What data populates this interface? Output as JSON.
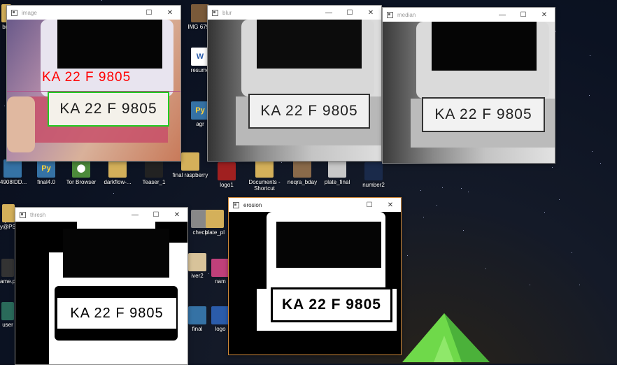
{
  "desktop": {
    "icons": [
      {
        "name": "desktop-icon-img",
        "label": "IMG 6795",
        "color": "#7a5a3a"
      },
      {
        "name": "desktop-icon-resume",
        "label": "resume",
        "color": "#2b5caa"
      },
      {
        "name": "desktop-icon-agr",
        "label": "agr",
        "color": "#3572a5"
      },
      {
        "name": "desktop-icon-final40",
        "label": "final4.0",
        "color": "#3572a5"
      },
      {
        "name": "desktop-icon-tor",
        "label": "Tor Browser",
        "color": "#4c8a3a"
      },
      {
        "name": "desktop-icon-darkflow",
        "label": "darkflow-...",
        "color": "#c8a24a"
      },
      {
        "name": "desktop-icon-teaser",
        "label": "Teaser_1",
        "color": "#222"
      },
      {
        "name": "desktop-icon-final-raspberry",
        "label": "final raspberry",
        "color": "#d4b05a"
      },
      {
        "name": "desktop-icon-logo1",
        "label": "logo1",
        "color": "#a02020"
      },
      {
        "name": "desktop-icon-documents",
        "label": "Documents - Shortcut",
        "color": "#d4b05a"
      },
      {
        "name": "desktop-icon-neqra",
        "label": "neqra_bday",
        "color": "#8a6a4a"
      },
      {
        "name": "desktop-icon-plate-final",
        "label": "plate_final",
        "color": "#c8c8c8"
      },
      {
        "name": "desktop-icon-number2",
        "label": "number2",
        "color": "#1a2a4a"
      },
      {
        "name": "desktop-icon-4908",
        "label": "4908IDD...",
        "color": "#3572a5"
      },
      {
        "name": "desktop-icon-check",
        "label": "check",
        "color": "#888"
      },
      {
        "name": "desktop-icon-plate",
        "label": "plate_pl",
        "color": "#d4b05a"
      },
      {
        "name": "desktop-icon-driver2",
        "label": "iver2",
        "color": "#d8c39a"
      },
      {
        "name": "desktop-icon-nam",
        "label": "nam",
        "color": "#c0407a"
      },
      {
        "name": "desktop-icon-final",
        "label": "final",
        "color": "#3572a5"
      },
      {
        "name": "desktop-icon-logo",
        "label": "logo",
        "color": "#2b5caa"
      },
      {
        "name": "desktop-icon-user",
        "label": "user",
        "color": "#2a6a5a"
      },
      {
        "name": "desktop-icon-ame",
        "label": "ame.p",
        "color": "#333"
      },
      {
        "name": "desktop-icon-ypsk",
        "label": "y@PSK",
        "color": "#d4b05a"
      },
      {
        "name": "desktop-icon-p",
        "label": "p",
        "color": "#4c8a3a"
      },
      {
        "name": "desktop-icon-bra",
        "label": "bra",
        "color": "#d4b05a"
      }
    ]
  },
  "windows": {
    "image": {
      "title": "image",
      "detected_text": "KA 22 F 9805",
      "plate_text": "KA 22 F 9805",
      "accent": "#ff0000",
      "box_color": "#22cc22"
    },
    "blur": {
      "title": "blur",
      "plate_text": "KA 22 F 9805"
    },
    "median": {
      "title": "median",
      "plate_text": "KA 22 F 9805"
    },
    "thresh": {
      "title": "thresh",
      "plate_text": "KA 22 F 9805"
    },
    "erosion": {
      "title": "erosion",
      "plate_text": "KA 22 F 9805"
    }
  },
  "controls": {
    "minimize": "—",
    "maximize": "☐",
    "close": "✕"
  }
}
